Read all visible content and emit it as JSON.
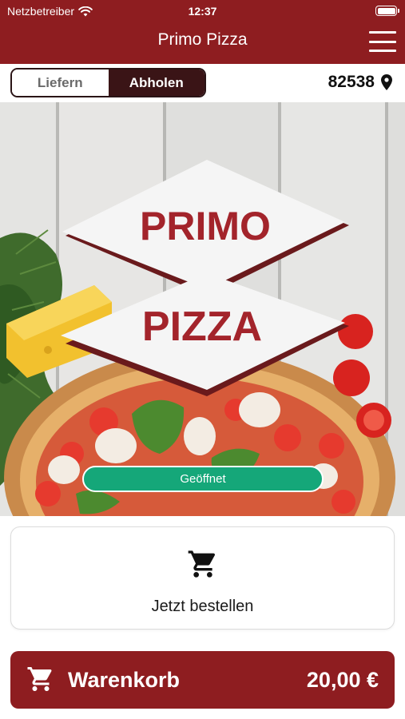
{
  "status_bar": {
    "carrier": "Netzbetreiber",
    "time": "12:37",
    "icons": [
      "wifi-icon",
      "battery-icon"
    ]
  },
  "header": {
    "title": "Primo Pizza",
    "menu_icon": "hamburger-menu-icon"
  },
  "mode_toggle": {
    "options": [
      {
        "label": "Liefern",
        "selected": false
      },
      {
        "label": "Abholen",
        "selected": true
      }
    ]
  },
  "location": {
    "postal_code": "82538",
    "icon": "location-pin-icon"
  },
  "hero": {
    "logo_line_1": "PRIMO",
    "logo_line_2": "PIZZA",
    "status_badge": "Geöffnet"
  },
  "order_card": {
    "icon": "shopping-cart-icon",
    "label": "Jetzt bestellen"
  },
  "cart": {
    "icon": "shopping-cart-icon",
    "label": "Warenkorb",
    "total": "20,00 €"
  },
  "colors": {
    "brand": "#8e1d20",
    "toggle_active": "#3a1416",
    "open_badge": "#15a779",
    "logo_text": "#a3242b"
  }
}
